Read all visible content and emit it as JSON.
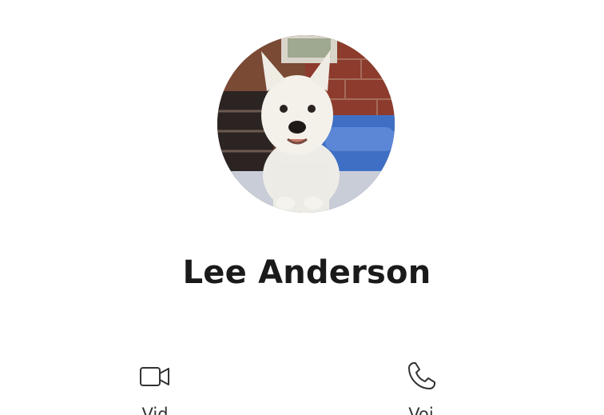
{
  "profile": {
    "name": "Lee Anderson",
    "avatar_icon": "profile-photo-dog"
  },
  "actions": [
    {
      "id": "video",
      "icon": "video-camera-icon",
      "label": "Vid"
    },
    {
      "id": "voice",
      "icon": "phone-icon",
      "label": "Voi"
    }
  ],
  "colors": {
    "text": "#1a1a1a",
    "icon": "#333333",
    "background": "#ffffff"
  }
}
